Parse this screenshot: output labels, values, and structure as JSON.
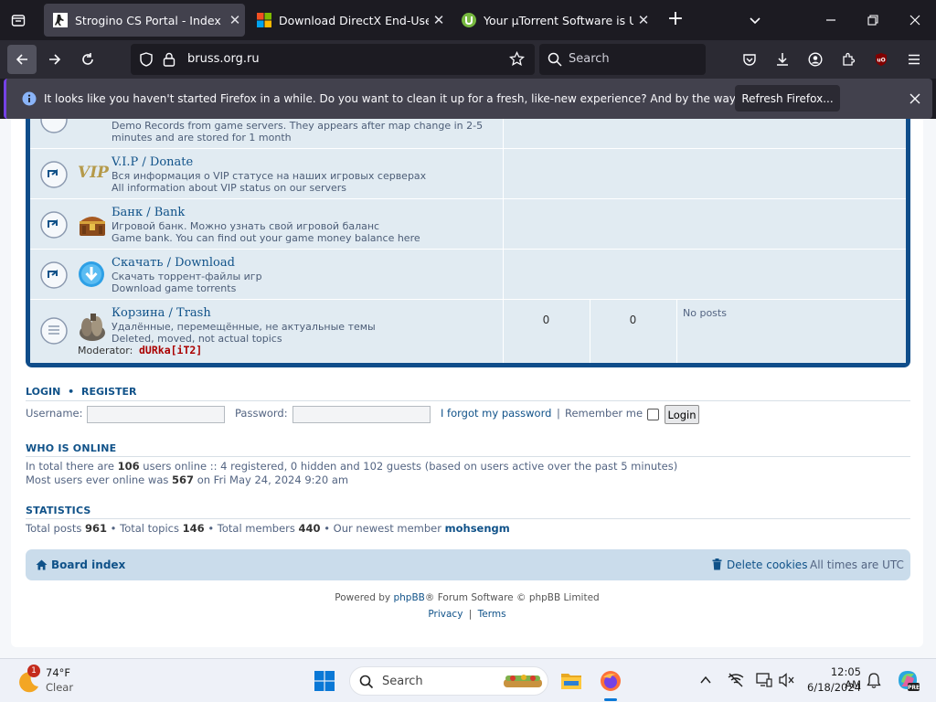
{
  "browser": {
    "tabs": [
      {
        "title": "Strogino CS Portal - Index page",
        "active": true
      },
      {
        "title": "Download DirectX End-User Run",
        "active": false
      },
      {
        "title": "Your µTorrent Software is Up to",
        "active": false
      }
    ],
    "url": "bruss.org.ru",
    "search_placeholder": "Search",
    "notification": {
      "message": "It looks like you haven't started Firefox in a while. Do you want to clean it up for a fresh, like-new experience? And by the way, welcome back!",
      "button": "Refresh Firefox..."
    }
  },
  "forums": [
    {
      "desc_en": "Demo Records from game servers. They appears after map change in 2-5 minutes and are stored for 1 month"
    },
    {
      "title": "V.I.P / Donate",
      "desc_ru": "Вся информация о VIP статусе на наших игровых серверах",
      "desc_en": "All information about VIP status on our servers",
      "image_text": "VIP"
    },
    {
      "title": "Банк / Bank",
      "desc_ru": "Игровой банк. Можно узнать свой игровой баланс",
      "desc_en": "Game bank. You can find out your game money balance here"
    },
    {
      "title": "Скачать / Download",
      "desc_ru": "Скачать торрент-файлы игр",
      "desc_en": "Download game torrents"
    },
    {
      "title": "Корзина / Trash",
      "desc_ru": "Удалённые, перемещённые, не актуальные темы",
      "desc_en": "Deleted, moved, not actual topics",
      "moderator_label": "Moderator:",
      "moderator": "dURka[iT2]",
      "topics": "0",
      "posts": "0",
      "last_post": "No posts"
    }
  ],
  "login": {
    "login_link": "LOGIN",
    "separator": "•",
    "register_link": "REGISTER",
    "username_label": "Username:",
    "password_label": "Password:",
    "forgot": "I forgot my password",
    "pipe": "|",
    "remember": "Remember me",
    "button": "Login"
  },
  "who_online": {
    "heading": "WHO IS ONLINE",
    "line1_pre": "In total there are",
    "total": "106",
    "line1_post": "users online :: 4 registered, 0 hidden and 102 guests (based on users active over the past 5 minutes)",
    "line2_pre": "Most users ever online was",
    "max": "567",
    "line2_post": "on Fri May 24, 2024 9:20 am"
  },
  "statistics": {
    "heading": "STATISTICS",
    "posts_label": "Total posts",
    "posts": "961",
    "topics_label": "Total topics",
    "topics": "146",
    "members_label": "Total members",
    "members": "440",
    "newest_label": "Our newest member",
    "newest": "mohsengm",
    "bullet": "•"
  },
  "footer": {
    "board_index": "Board index",
    "delete_cookies": "Delete cookies",
    "timezone": "All times are UTC",
    "powered_pre": "Powered by",
    "phpbb": "phpBB",
    "powered_post": "® Forum Software © phpBB Limited",
    "privacy": "Privacy",
    "pipe": "|",
    "terms": "Terms"
  },
  "taskbar": {
    "weather_temp": "74°F",
    "weather_cond": "Clear",
    "weather_badge": "1",
    "search": "Search",
    "time": "12:05 AM",
    "date": "6/18/2024"
  },
  "colors": {
    "accent": "#105289",
    "forum_border": "#0f4d8a",
    "row_bg": "#e1ebf2",
    "moderator": "#aa0000",
    "firefox_purple": "#7542e5"
  }
}
